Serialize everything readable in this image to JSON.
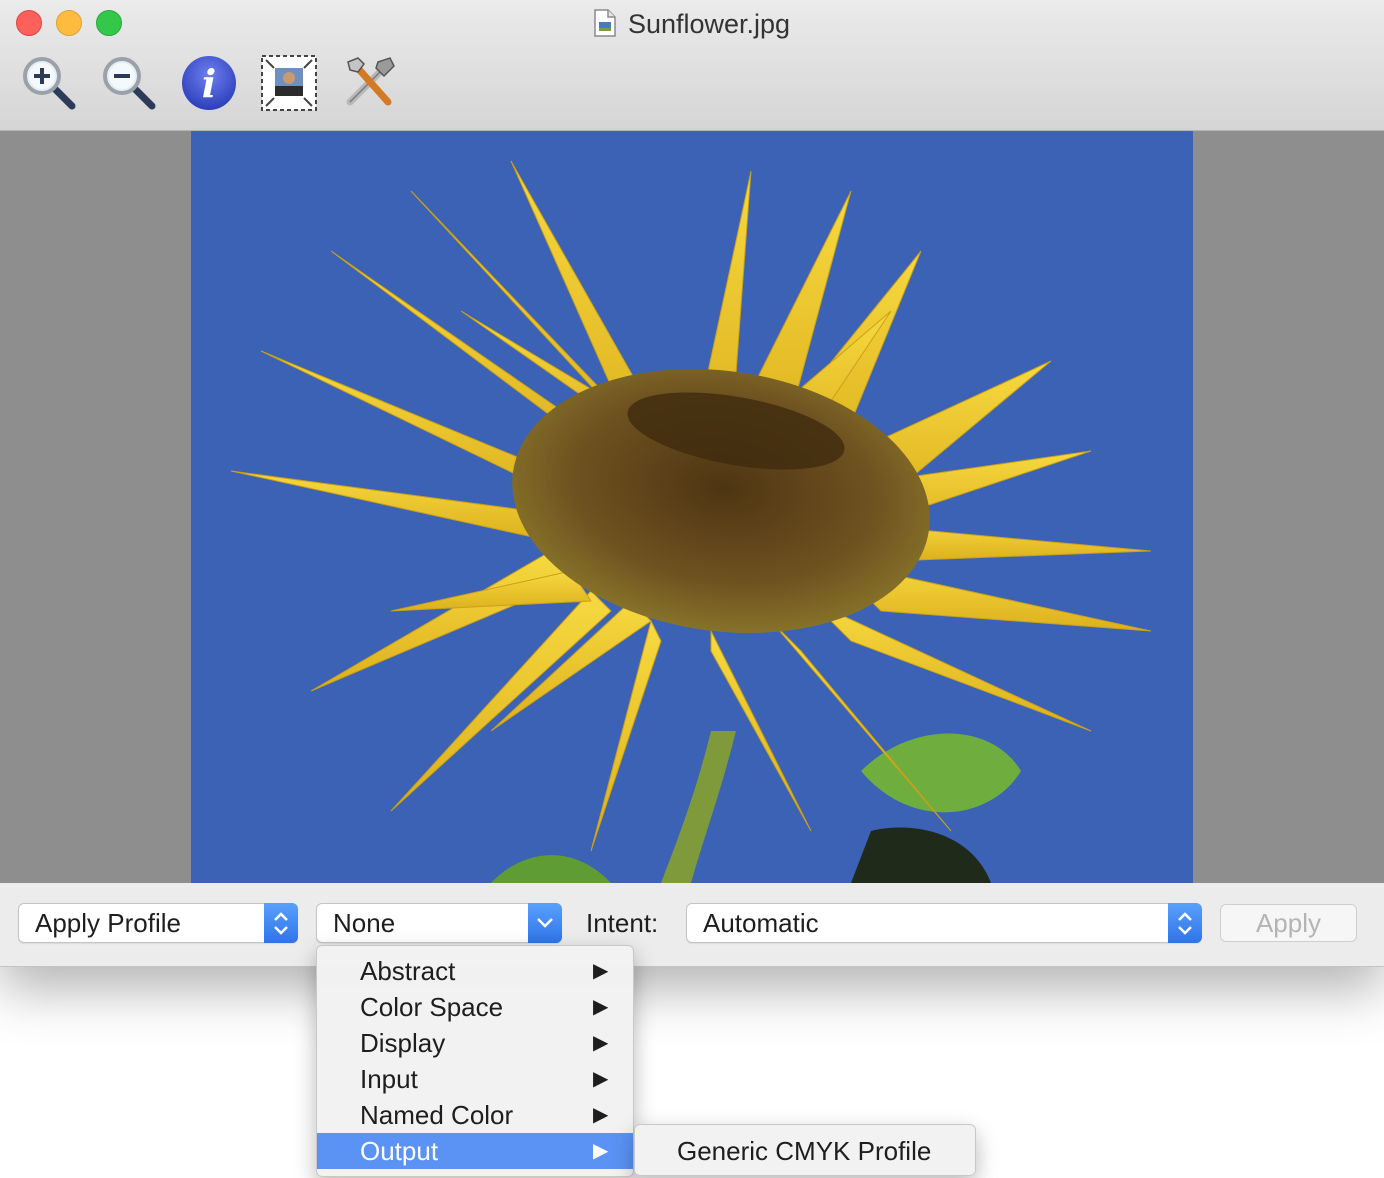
{
  "window": {
    "title": "Sunflower.jpg",
    "toolbar": {
      "zoom_in_icon": "zoom-in-magnifier",
      "zoom_out_icon": "zoom-out-magnifier",
      "info_icon": "info-circle",
      "crop_icon": "crop-photo",
      "adjust_icon": "wrench-and-hammer"
    }
  },
  "viewer": {
    "image_description": "sunflower on blue sky"
  },
  "bottom_bar": {
    "action_popup": "Apply Profile",
    "profile_popup": "None",
    "intent_label": "Intent:",
    "intent_popup": "Automatic",
    "apply_button": "Apply"
  },
  "profile_menu": {
    "items": [
      {
        "label": "Abstract",
        "arrow": "▶"
      },
      {
        "label": "Color Space",
        "arrow": "▶"
      },
      {
        "label": "Display",
        "arrow": "▶"
      },
      {
        "label": "Input",
        "arrow": "▶"
      },
      {
        "label": "Named Color",
        "arrow": "▶"
      },
      {
        "label": "Output",
        "arrow": "▶",
        "selected": true
      }
    ],
    "submenu": {
      "items": [
        {
          "label": "Generic CMYK Profile"
        }
      ]
    }
  },
  "colors": {
    "sky": "#3b62b4",
    "petal": "#f3cf2a",
    "seed_head": "#6b4d1c",
    "accent": "#3d82f5",
    "menu_highlight": "#5a93f4"
  }
}
